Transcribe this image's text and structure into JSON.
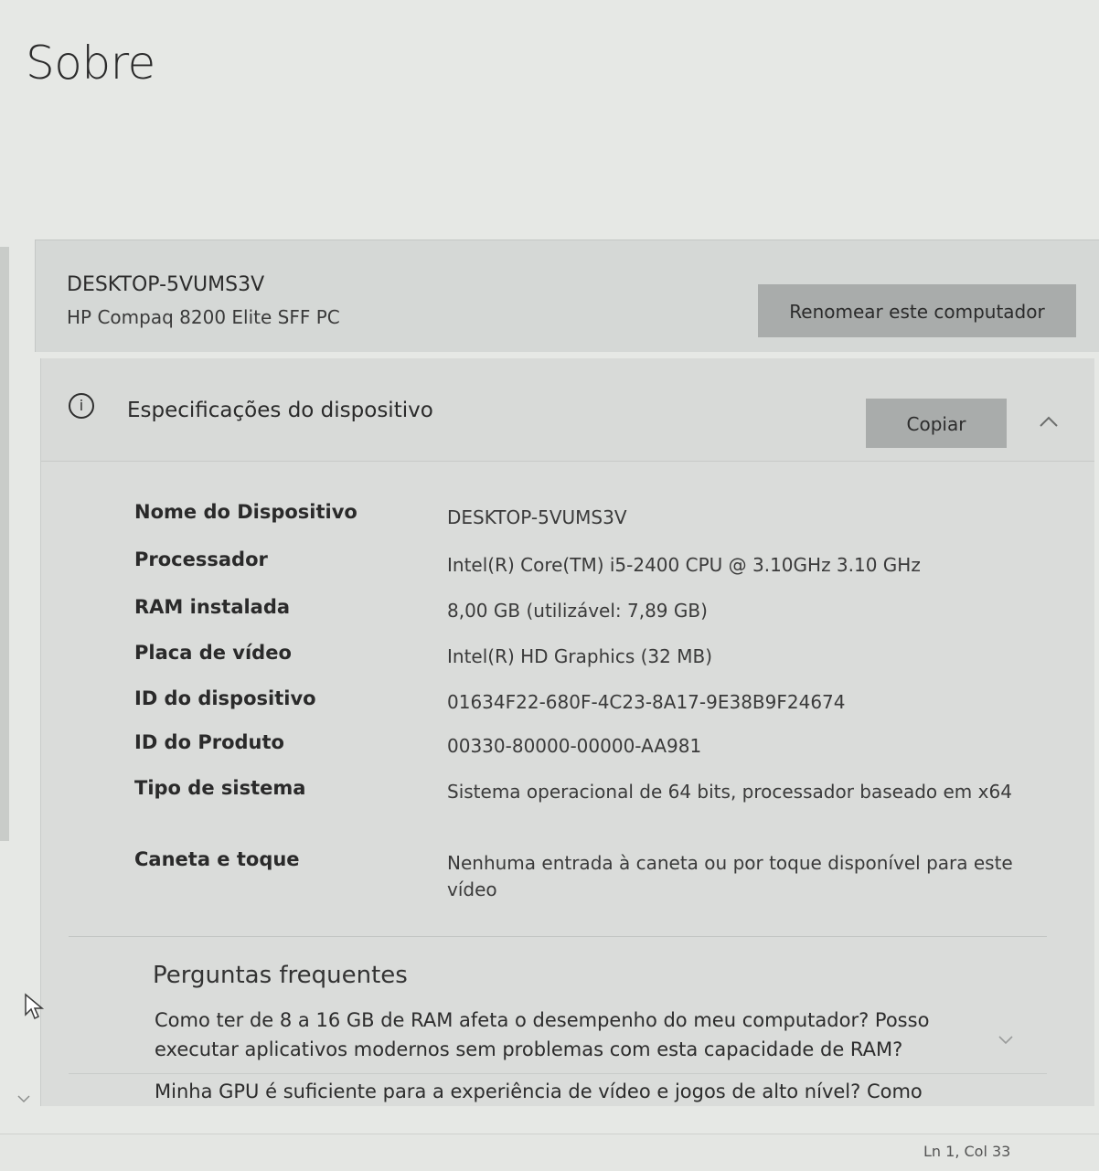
{
  "page": {
    "title": "Sobre"
  },
  "device": {
    "name": "DESKTOP-5VUMS3V",
    "model": "HP Compaq 8200 Elite SFF PC",
    "rename_label": "Renomear este computador"
  },
  "specs": {
    "title": "Especificações do dispositivo",
    "copy_label": "Copiar",
    "rows": [
      {
        "label": "Nome do Dispositivo",
        "value": "DESKTOP-5VUMS3V"
      },
      {
        "label": "Processador",
        "value": "Intel(R) Core(TM) i5-2400 CPU @ 3.10GHz   3.10 GHz"
      },
      {
        "label": "RAM instalada",
        "value": "8,00 GB (utilizável: 7,89 GB)"
      },
      {
        "label": "Placa de vídeo",
        "value": "Intel(R) HD Graphics (32 MB)"
      },
      {
        "label": "ID do dispositivo",
        "value": "01634F22-680F-4C23-8A17-9E38B9F24674"
      },
      {
        "label": "ID do Produto",
        "value": "00330-80000-00000-AA981"
      },
      {
        "label": "Tipo de sistema",
        "value": "Sistema operacional de 64 bits, processador baseado em x64"
      },
      {
        "label": "Caneta e toque",
        "value": "Nenhuma entrada à caneta ou por toque disponível para este vídeo"
      }
    ]
  },
  "faq": {
    "title": "Perguntas frequentes",
    "items": [
      "Como ter de 8 a 16 GB de RAM afeta o desempenho do meu computador? Posso executar aplicativos modernos sem problemas com esta capacidade de RAM?",
      "Minha GPU é suficiente para a experiência de vídeo e jogos de alto nível? Como"
    ]
  },
  "status_bar": {
    "position": "Ln 1, Col 33"
  },
  "icons": {
    "info": "info-icon",
    "collapse": "chevron-up-icon",
    "faq_expand": "chevron-down-icon",
    "cursor": "mouse-pointer-icon",
    "scroll_down": "chevron-down-icon"
  }
}
